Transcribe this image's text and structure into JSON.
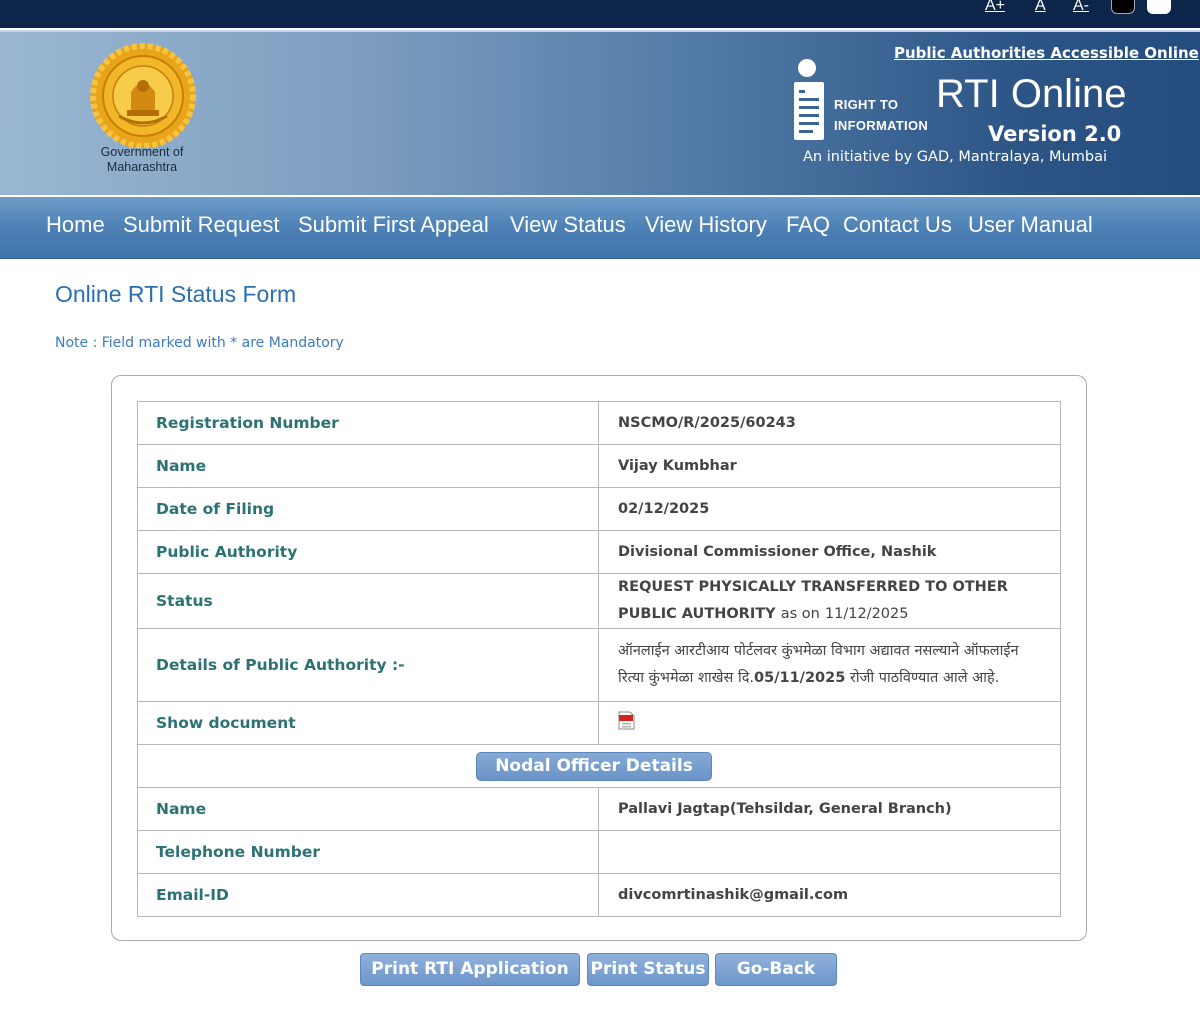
{
  "topbar": {
    "font_increase": "A+",
    "font_normal": "A",
    "font_decrease": "A-",
    "contrast_dark_icon": "contrast-dark-icon",
    "contrast_light_icon": "contrast-light-icon"
  },
  "header": {
    "emblem_icon": "maharashtra-emblem-icon",
    "govt_line1": "Government of",
    "govt_line2": "Maharashtra",
    "pa_link": "Public Authorities Accessible Online",
    "rti_logo_icon": "right-to-information-logo-icon",
    "rti_logo_line1": "RIGHT TO",
    "rti_logo_line2": "INFORMATION",
    "title": "RTI Online",
    "version": "Version 2.0",
    "initiative": "An initiative by GAD, Mantralaya, Mumbai"
  },
  "nav": {
    "items": [
      "Home",
      "Submit Request",
      "Submit First Appeal",
      "View Status",
      "View History",
      "FAQ",
      "Contact Us",
      "User Manual"
    ]
  },
  "page": {
    "title": "Online RTI Status Form",
    "note": "Note : Field marked with * are Mandatory"
  },
  "form": {
    "rows": [
      {
        "label": "Registration Number",
        "value": "NSCMO/R/2025/60243"
      },
      {
        "label": "Name",
        "value": "Vijay Kumbhar"
      },
      {
        "label": "Date of Filing",
        "value": "02/12/2025"
      },
      {
        "label": "Public Authority",
        "value": "Divisional Commissioner Office, Nashik"
      },
      {
        "label": "Status",
        "value": "REQUEST PHYSICALLY TRANSFERRED TO OTHER PUBLIC AUTHORITY",
        "as_on_label": "as on",
        "as_on_date": "11/12/2025"
      },
      {
        "label": "Details of Public Authority :-",
        "value_part1": "ऑनलाईन आरटीआय पोर्टलवर कुंभमेळा विभाग अद्यावत नसल्याने ऑफलाईन रित्या कुंभमेळा शाखेस दि.",
        "value_date": "05/11/2025",
        "value_part2": " रोजी पाठविण्यात आले आहे."
      },
      {
        "label": "Show document",
        "icon": "pdf-document-icon"
      }
    ],
    "nodal_header": "Nodal Officer Details",
    "nodal_rows": [
      {
        "label": "Name",
        "value": "Pallavi Jagtap(Tehsildar, General Branch)"
      },
      {
        "label": "Telephone Number",
        "value": ""
      },
      {
        "label": "Email-ID",
        "value": "divcomrtinashik@gmail.com"
      }
    ]
  },
  "buttons": {
    "print_application": "Print RTI Application",
    "print_status": "Print Status",
    "go_back": "Go-Back"
  },
  "colors": {
    "topbar": "#0d2549",
    "nav": "#4d81b6",
    "label_text": "#2c7275",
    "title_text": "#2a6fb0",
    "button": "#7aa0d2"
  }
}
